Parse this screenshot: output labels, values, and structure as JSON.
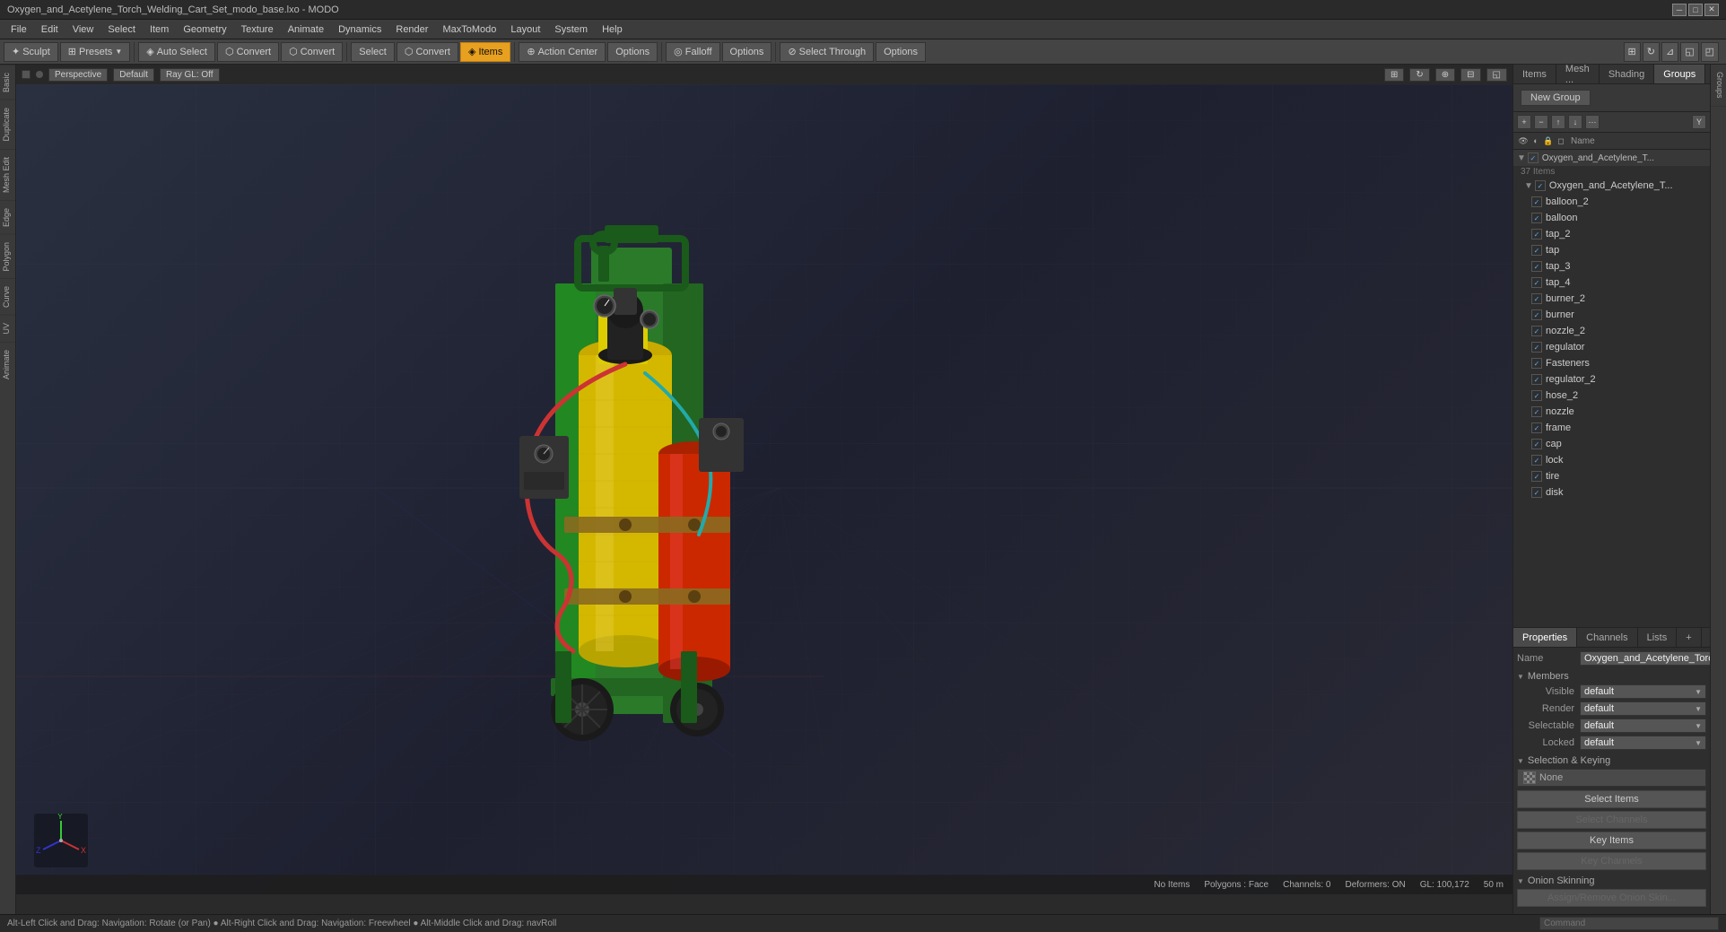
{
  "titlebar": {
    "title": "Oxygen_and_Acetylene_Torch_Welding_Cart_Set_modo_base.lxo - MODO",
    "controls": [
      "─",
      "□",
      "✕"
    ]
  },
  "menubar": {
    "items": [
      "File",
      "Edit",
      "View",
      "Select",
      "Item",
      "Geometry",
      "Texture",
      "Animate",
      "Dynamics",
      "Render",
      "MaxToModo",
      "Layout",
      "System",
      "Help"
    ]
  },
  "toolbar": {
    "sculpt_label": "Sculpt",
    "presets_label": "Presets",
    "auto_select_label": "Auto Select",
    "convert1_label": "Convert",
    "convert2_label": "Convert",
    "convert3_label": "Convert",
    "select_label": "Select",
    "items_label": "Items",
    "action_center_label": "Action Center",
    "options1_label": "Options",
    "falloff_label": "Falloff",
    "options2_label": "Options",
    "select_through_label": "Select Through",
    "options3_label": "Options"
  },
  "viewport": {
    "mode": "Perspective",
    "shading": "Default",
    "ray_gl": "Ray GL: Off",
    "icons": [
      "nav1",
      "nav2",
      "nav3",
      "nav4",
      "nav5"
    ]
  },
  "status": {
    "no_items": "No Items",
    "polygons_face": "Polygons : Face",
    "channels": "Channels: 0",
    "deformers": "Deformers: ON",
    "gl": "GL: 100,172",
    "zoom": "50 m"
  },
  "statusbar_bottom": {
    "hint": "Alt-Left Click and Drag: Navigation: Rotate (or Pan)  ●  Alt-Right Click and Drag: Navigation: Freewheel  ●  Alt-Middle Click and Drag: navRoll",
    "command_placeholder": "Command"
  },
  "right_panel": {
    "top_tabs": [
      "Items",
      "Mesh ...",
      "Shading",
      "Groups"
    ],
    "active_tab": "Groups",
    "new_group_label": "New Group",
    "scene_toolbar_icons": [
      "+",
      "−",
      "↑",
      "↓",
      "⋯"
    ],
    "filter_cols": [
      "",
      "",
      "Name"
    ],
    "scene_root": {
      "name": "Oxygen_and_Acetylene_T...",
      "count": "37 Items",
      "items": [
        {
          "name": "Oxygen_and_Acetylene_T...",
          "checked": true,
          "indent": 0,
          "is_group": true
        },
        {
          "name": "balloon_2",
          "checked": true,
          "indent": 1
        },
        {
          "name": "balloon",
          "checked": true,
          "indent": 1
        },
        {
          "name": "tap_2",
          "checked": true,
          "indent": 1
        },
        {
          "name": "tap",
          "checked": true,
          "indent": 1
        },
        {
          "name": "tap_3",
          "checked": true,
          "indent": 1
        },
        {
          "name": "tap_4",
          "checked": true,
          "indent": 1
        },
        {
          "name": "burner_2",
          "checked": true,
          "indent": 1
        },
        {
          "name": "burner",
          "checked": true,
          "indent": 1
        },
        {
          "name": "nozzle_2",
          "checked": true,
          "indent": 1
        },
        {
          "name": "regulator",
          "checked": true,
          "indent": 1
        },
        {
          "name": "Fasteners",
          "checked": true,
          "indent": 1
        },
        {
          "name": "regulator_2",
          "checked": true,
          "indent": 1
        },
        {
          "name": "hose_2",
          "checked": true,
          "indent": 1
        },
        {
          "name": "nozzle",
          "checked": true,
          "indent": 1
        },
        {
          "name": "frame",
          "checked": true,
          "indent": 1
        },
        {
          "name": "cap",
          "checked": true,
          "indent": 1
        },
        {
          "name": "lock",
          "checked": true,
          "indent": 1
        },
        {
          "name": "tire",
          "checked": true,
          "indent": 1
        },
        {
          "name": "disk",
          "checked": true,
          "indent": 1
        }
      ]
    }
  },
  "properties": {
    "tabs": [
      "Properties",
      "Channels",
      "Lists",
      "+"
    ],
    "active_tab": "Properties",
    "name_label": "Name",
    "name_value": "Oxygen_and_Acetylene_Torch_...",
    "sections": {
      "members": {
        "label": "Members",
        "fields": [
          {
            "label": "Visible",
            "value": "default"
          },
          {
            "label": "Render",
            "value": "default"
          },
          {
            "label": "Selectable",
            "value": "default"
          },
          {
            "label": "Locked",
            "value": "default"
          }
        ]
      },
      "selection_keying": {
        "label": "Selection & Keying",
        "none_label": "None",
        "buttons": [
          {
            "label": "Select Items",
            "disabled": false
          },
          {
            "label": "Select Channels",
            "disabled": true
          },
          {
            "label": "Key Items",
            "disabled": false
          },
          {
            "label": "Key Channels",
            "disabled": true
          }
        ]
      },
      "onion_skinning": {
        "label": "Onion Skinning",
        "button": "Assign/Remove Onion Skin..."
      }
    }
  },
  "far_right": {
    "tabs": [
      "Groups"
    ]
  }
}
